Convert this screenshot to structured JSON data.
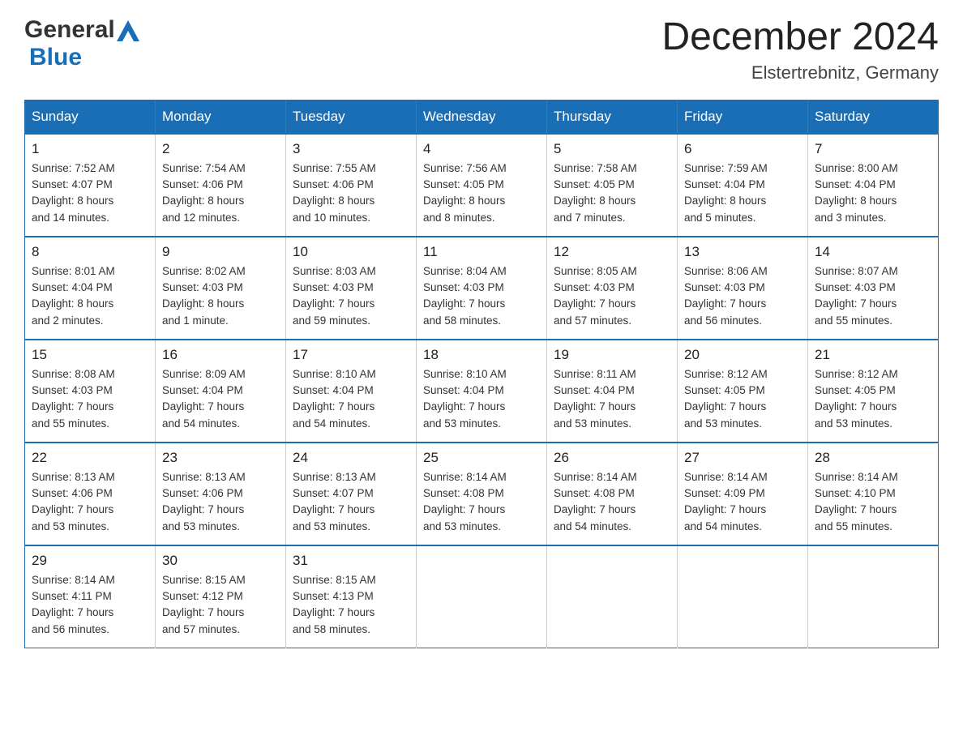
{
  "header": {
    "logo_general": "General",
    "logo_blue": "Blue",
    "month_year": "December 2024",
    "location": "Elstertrebnitz, Germany"
  },
  "days_of_week": [
    "Sunday",
    "Monday",
    "Tuesday",
    "Wednesday",
    "Thursday",
    "Friday",
    "Saturday"
  ],
  "weeks": [
    [
      {
        "day": "1",
        "info": "Sunrise: 7:52 AM\nSunset: 4:07 PM\nDaylight: 8 hours\nand 14 minutes."
      },
      {
        "day": "2",
        "info": "Sunrise: 7:54 AM\nSunset: 4:06 PM\nDaylight: 8 hours\nand 12 minutes."
      },
      {
        "day": "3",
        "info": "Sunrise: 7:55 AM\nSunset: 4:06 PM\nDaylight: 8 hours\nand 10 minutes."
      },
      {
        "day": "4",
        "info": "Sunrise: 7:56 AM\nSunset: 4:05 PM\nDaylight: 8 hours\nand 8 minutes."
      },
      {
        "day": "5",
        "info": "Sunrise: 7:58 AM\nSunset: 4:05 PM\nDaylight: 8 hours\nand 7 minutes."
      },
      {
        "day": "6",
        "info": "Sunrise: 7:59 AM\nSunset: 4:04 PM\nDaylight: 8 hours\nand 5 minutes."
      },
      {
        "day": "7",
        "info": "Sunrise: 8:00 AM\nSunset: 4:04 PM\nDaylight: 8 hours\nand 3 minutes."
      }
    ],
    [
      {
        "day": "8",
        "info": "Sunrise: 8:01 AM\nSunset: 4:04 PM\nDaylight: 8 hours\nand 2 minutes."
      },
      {
        "day": "9",
        "info": "Sunrise: 8:02 AM\nSunset: 4:03 PM\nDaylight: 8 hours\nand 1 minute."
      },
      {
        "day": "10",
        "info": "Sunrise: 8:03 AM\nSunset: 4:03 PM\nDaylight: 7 hours\nand 59 minutes."
      },
      {
        "day": "11",
        "info": "Sunrise: 8:04 AM\nSunset: 4:03 PM\nDaylight: 7 hours\nand 58 minutes."
      },
      {
        "day": "12",
        "info": "Sunrise: 8:05 AM\nSunset: 4:03 PM\nDaylight: 7 hours\nand 57 minutes."
      },
      {
        "day": "13",
        "info": "Sunrise: 8:06 AM\nSunset: 4:03 PM\nDaylight: 7 hours\nand 56 minutes."
      },
      {
        "day": "14",
        "info": "Sunrise: 8:07 AM\nSunset: 4:03 PM\nDaylight: 7 hours\nand 55 minutes."
      }
    ],
    [
      {
        "day": "15",
        "info": "Sunrise: 8:08 AM\nSunset: 4:03 PM\nDaylight: 7 hours\nand 55 minutes."
      },
      {
        "day": "16",
        "info": "Sunrise: 8:09 AM\nSunset: 4:04 PM\nDaylight: 7 hours\nand 54 minutes."
      },
      {
        "day": "17",
        "info": "Sunrise: 8:10 AM\nSunset: 4:04 PM\nDaylight: 7 hours\nand 54 minutes."
      },
      {
        "day": "18",
        "info": "Sunrise: 8:10 AM\nSunset: 4:04 PM\nDaylight: 7 hours\nand 53 minutes."
      },
      {
        "day": "19",
        "info": "Sunrise: 8:11 AM\nSunset: 4:04 PM\nDaylight: 7 hours\nand 53 minutes."
      },
      {
        "day": "20",
        "info": "Sunrise: 8:12 AM\nSunset: 4:05 PM\nDaylight: 7 hours\nand 53 minutes."
      },
      {
        "day": "21",
        "info": "Sunrise: 8:12 AM\nSunset: 4:05 PM\nDaylight: 7 hours\nand 53 minutes."
      }
    ],
    [
      {
        "day": "22",
        "info": "Sunrise: 8:13 AM\nSunset: 4:06 PM\nDaylight: 7 hours\nand 53 minutes."
      },
      {
        "day": "23",
        "info": "Sunrise: 8:13 AM\nSunset: 4:06 PM\nDaylight: 7 hours\nand 53 minutes."
      },
      {
        "day": "24",
        "info": "Sunrise: 8:13 AM\nSunset: 4:07 PM\nDaylight: 7 hours\nand 53 minutes."
      },
      {
        "day": "25",
        "info": "Sunrise: 8:14 AM\nSunset: 4:08 PM\nDaylight: 7 hours\nand 53 minutes."
      },
      {
        "day": "26",
        "info": "Sunrise: 8:14 AM\nSunset: 4:08 PM\nDaylight: 7 hours\nand 54 minutes."
      },
      {
        "day": "27",
        "info": "Sunrise: 8:14 AM\nSunset: 4:09 PM\nDaylight: 7 hours\nand 54 minutes."
      },
      {
        "day": "28",
        "info": "Sunrise: 8:14 AM\nSunset: 4:10 PM\nDaylight: 7 hours\nand 55 minutes."
      }
    ],
    [
      {
        "day": "29",
        "info": "Sunrise: 8:14 AM\nSunset: 4:11 PM\nDaylight: 7 hours\nand 56 minutes."
      },
      {
        "day": "30",
        "info": "Sunrise: 8:15 AM\nSunset: 4:12 PM\nDaylight: 7 hours\nand 57 minutes."
      },
      {
        "day": "31",
        "info": "Sunrise: 8:15 AM\nSunset: 4:13 PM\nDaylight: 7 hours\nand 58 minutes."
      },
      {
        "day": "",
        "info": ""
      },
      {
        "day": "",
        "info": ""
      },
      {
        "day": "",
        "info": ""
      },
      {
        "day": "",
        "info": ""
      }
    ]
  ]
}
